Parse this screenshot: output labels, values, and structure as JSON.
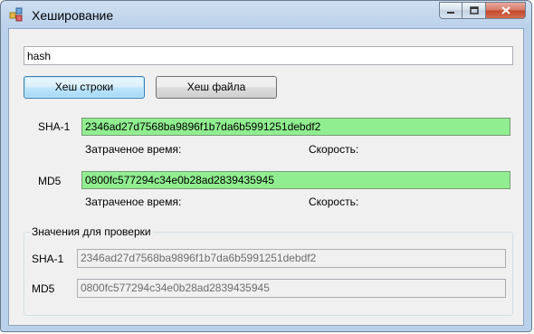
{
  "window": {
    "title": "Хеширование",
    "icon": "app-icon"
  },
  "caption": {
    "minimize_icon": "minimize-icon",
    "maximize_icon": "maximize-icon",
    "close_icon": "close-icon"
  },
  "input": {
    "value": "hash"
  },
  "buttons": {
    "hash_string": "Хеш строки",
    "hash_file": "Хеш файла"
  },
  "sha1": {
    "label": "SHA-1",
    "value": "2346ad27d7568ba9896f1b7da6b5991251debdf2",
    "time_label": "Затраченое время:",
    "speed_label": "Скорость:"
  },
  "md5": {
    "label": "MD5",
    "value": "0800fc577294c34e0b28ad2839435945",
    "time_label": "Затраченое время:",
    "speed_label": "Скорость:"
  },
  "check_group": {
    "title": "Значения для проверки",
    "sha1_label": "SHA-1",
    "sha1_value": "2346ad27d7568ba9896f1b7da6b5991251debdf2",
    "md5_label": "MD5",
    "md5_value": "0800fc577294c34e0b28ad2839435945"
  },
  "colors": {
    "hash_bg": "#90ee90",
    "window_frame": "#b9d1ea",
    "close_button": "#c5462d"
  }
}
